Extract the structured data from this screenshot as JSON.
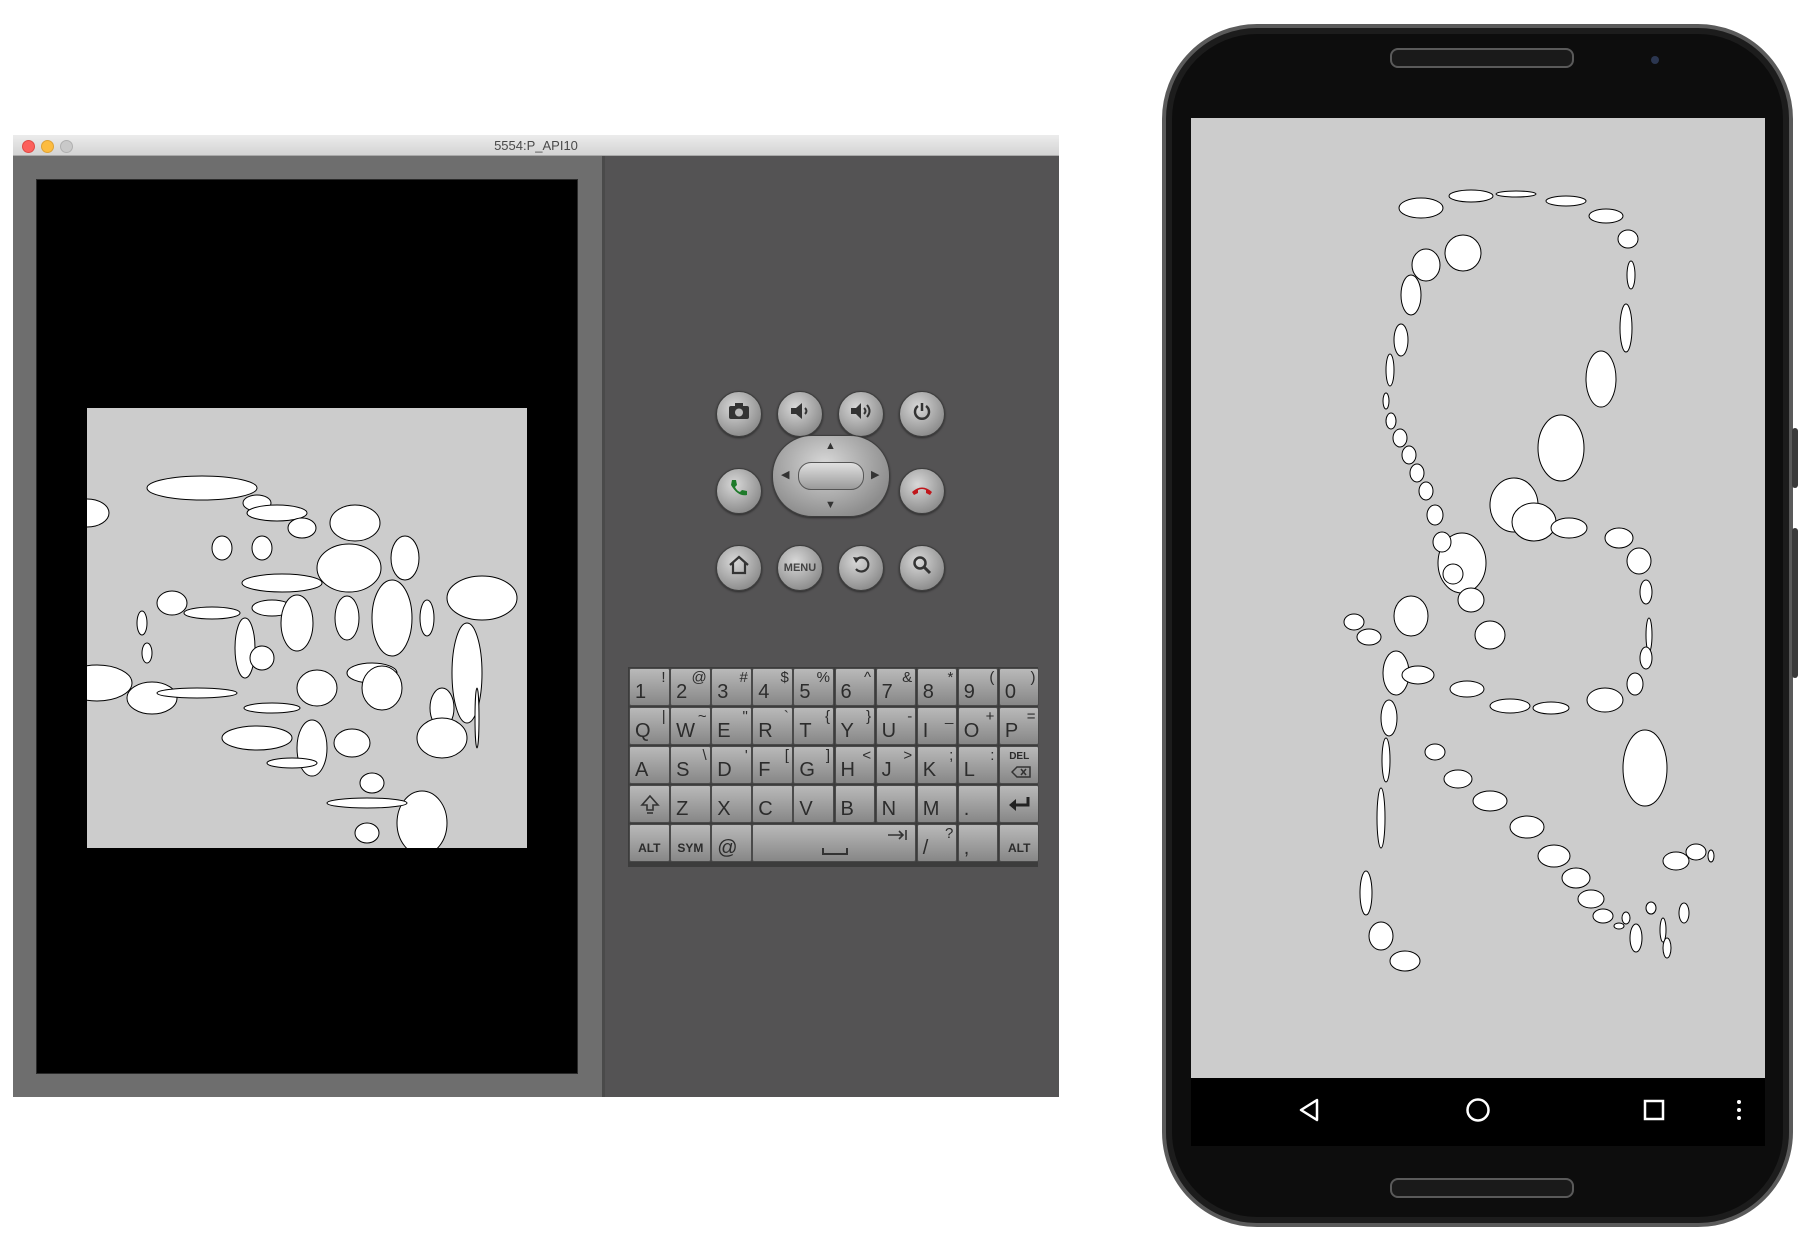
{
  "window": {
    "title": "5554:P_API10"
  },
  "controls": {
    "camera_icon": "camera-icon",
    "volume_down_icon": "volume-down-icon",
    "volume_up_icon": "volume-up-icon",
    "power_icon": "power-icon",
    "call_icon": "call-icon",
    "end_call_icon": "end-call-icon",
    "home_icon": "home-icon",
    "menu_label": "MENU",
    "back_icon": "back-icon",
    "search_icon": "search-icon"
  },
  "keyboard": {
    "rows": [
      [
        [
          "1",
          "!"
        ],
        [
          "2",
          "@"
        ],
        [
          "3",
          "#"
        ],
        [
          "4",
          "$"
        ],
        [
          "5",
          "%"
        ],
        [
          "6",
          "^"
        ],
        [
          "7",
          "&"
        ],
        [
          "8",
          "*"
        ],
        [
          "9",
          "("
        ],
        [
          "0",
          ")"
        ]
      ],
      [
        [
          "Q",
          "|"
        ],
        [
          "W",
          "~"
        ],
        [
          "E",
          "\""
        ],
        [
          "R",
          "`"
        ],
        [
          "T",
          "{"
        ],
        [
          "Y",
          "}"
        ],
        [
          "U",
          "-"
        ],
        [
          "I",
          "_"
        ],
        [
          "O",
          "+"
        ],
        [
          "P",
          "="
        ]
      ],
      [
        [
          "A",
          ""
        ],
        [
          "S",
          "\\"
        ],
        [
          "D",
          "'"
        ],
        [
          "F",
          "["
        ],
        [
          "G",
          "]"
        ],
        [
          "H",
          "<"
        ],
        [
          "J",
          ">"
        ],
        [
          "K",
          ";"
        ],
        [
          "L",
          ":"
        ]
      ],
      [
        [
          "Z",
          ""
        ],
        [
          "X",
          ""
        ],
        [
          "C",
          ""
        ],
        [
          "V",
          ""
        ],
        [
          "B",
          ""
        ],
        [
          "N",
          ""
        ],
        [
          "M",
          ""
        ],
        [
          ".",
          ""
        ]
      ]
    ],
    "del_label": "DEL",
    "alt_label": "ALT",
    "sym_label": "SYM",
    "at_label": "@",
    "slash_label": "/",
    "slash_alt": "?",
    "comma_label": ","
  },
  "phone": {
    "nav": {
      "back_icon": "back-triangle-icon",
      "home_icon": "home-circle-icon",
      "recents_icon": "recents-square-icon",
      "overflow_icon": "overflow-dots-icon"
    }
  },
  "colors": {
    "canvas_bg": "#cccccc",
    "emulator_chrome": "#545354",
    "phone_body": "#0d0d0d"
  }
}
